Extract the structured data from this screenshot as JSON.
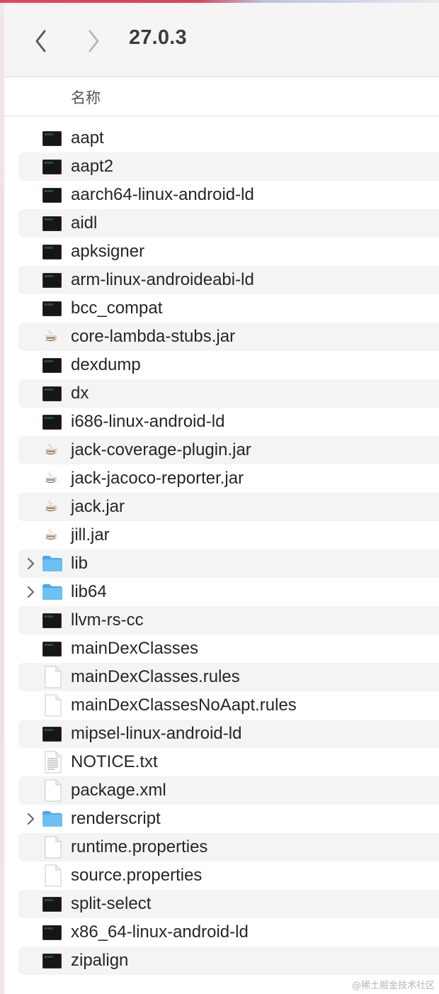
{
  "window": {
    "title": "27.0.3",
    "back_icon": "chevron-left-icon",
    "forward_icon": "chevron-right-icon"
  },
  "header": {
    "name_column": "名称"
  },
  "files": [
    {
      "name": "aapt",
      "type": "exec"
    },
    {
      "name": "aapt2",
      "type": "exec"
    },
    {
      "name": "aarch64-linux-android-ld",
      "type": "exec"
    },
    {
      "name": "aidl",
      "type": "exec"
    },
    {
      "name": "apksigner",
      "type": "exec"
    },
    {
      "name": "arm-linux-androideabi-ld",
      "type": "exec"
    },
    {
      "name": "bcc_compat",
      "type": "exec"
    },
    {
      "name": "core-lambda-stubs.jar",
      "type": "jar"
    },
    {
      "name": "dexdump",
      "type": "exec"
    },
    {
      "name": "dx",
      "type": "exec"
    },
    {
      "name": "i686-linux-android-ld",
      "type": "exec"
    },
    {
      "name": "jack-coverage-plugin.jar",
      "type": "jar"
    },
    {
      "name": "jack-jacoco-reporter.jar",
      "type": "jar"
    },
    {
      "name": "jack.jar",
      "type": "jar"
    },
    {
      "name": "jill.jar",
      "type": "jar"
    },
    {
      "name": "lib",
      "type": "folder"
    },
    {
      "name": "lib64",
      "type": "folder"
    },
    {
      "name": "llvm-rs-cc",
      "type": "exec"
    },
    {
      "name": "mainDexClasses",
      "type": "exec"
    },
    {
      "name": "mainDexClasses.rules",
      "type": "doc"
    },
    {
      "name": "mainDexClassesNoAapt.rules",
      "type": "doc"
    },
    {
      "name": "mipsel-linux-android-ld",
      "type": "exec"
    },
    {
      "name": "NOTICE.txt",
      "type": "text"
    },
    {
      "name": "package.xml",
      "type": "doc"
    },
    {
      "name": "renderscript",
      "type": "folder"
    },
    {
      "name": "runtime.properties",
      "type": "doc"
    },
    {
      "name": "source.properties",
      "type": "doc"
    },
    {
      "name": "split-select",
      "type": "exec"
    },
    {
      "name": "x86_64-linux-android-ld",
      "type": "exec"
    },
    {
      "name": "zipalign",
      "type": "exec"
    }
  ],
  "watermark": "@稀土掘金技术社区",
  "colors": {
    "folder": "#5fb6f0",
    "exec_bg": "#161616",
    "exec_text": "#35d43b",
    "stripe": "#f4f4f4"
  }
}
